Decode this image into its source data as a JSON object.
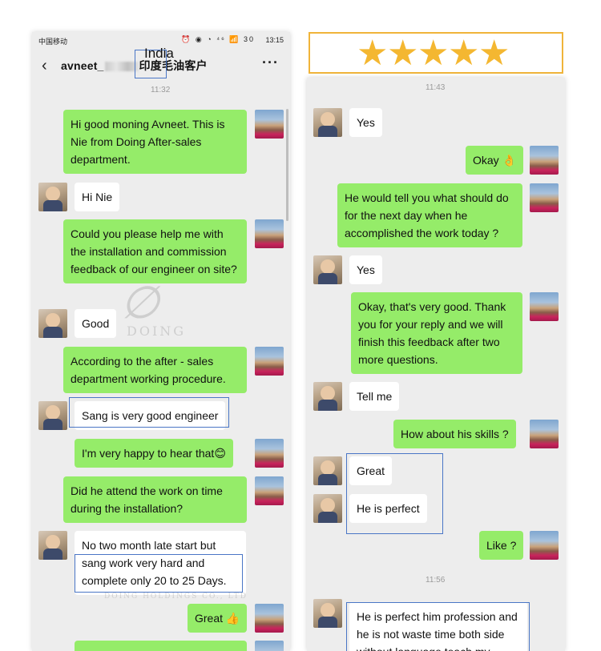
{
  "left": {
    "statusbar": {
      "carrier": "中国移动",
      "icons": "⏰ ◉ ◔ ⁴⁶ 📶 30",
      "time": "13:15"
    },
    "title": {
      "back": "‹",
      "name": "avneet_",
      "name_suffix": "印度毛油客户",
      "more": "···"
    },
    "annotation": "India",
    "timestamp": "11:32",
    "messages": [
      {
        "from": "me",
        "text": "Hi good moning Avneet. This is Nie from Doing After-sales department."
      },
      {
        "from": "them",
        "text": "Hi Nie"
      },
      {
        "from": "me",
        "text": "Could you please help me with the installation and commission feedback of our engineer on site?"
      },
      {
        "from": "them",
        "text": "Good"
      },
      {
        "from": "me",
        "text": "According to the after - sales department working procedure."
      },
      {
        "from": "them",
        "text": "Sang is very good engineer"
      },
      {
        "from": "me",
        "text": "I'm very happy to hear that😊"
      },
      {
        "from": "me",
        "text": "Did he attend the work on time during the installation?"
      },
      {
        "from": "them",
        "text": "No two month late start but sang work very hard and complete only 20 to 25 Days."
      },
      {
        "from": "me",
        "text": "Great 👍"
      }
    ],
    "watermark": {
      "logo": "DOING",
      "company": "DOING HOLDINGS CO., LTD"
    }
  },
  "right": {
    "rating": {
      "stars": 5,
      "symbol": "★"
    },
    "timestamp1": "11:43",
    "timestamp2": "11:56",
    "messages": [
      {
        "from": "them",
        "text": "Yes"
      },
      {
        "from": "me",
        "text": "Okay 👌"
      },
      {
        "from": "me",
        "text": "He would tell you what should do for the next day when he accomplished the work today ?"
      },
      {
        "from": "them",
        "text": "Yes"
      },
      {
        "from": "me",
        "text": "Okay, that's very good. Thank you for your reply and we will finish this feedback after two more questions."
      },
      {
        "from": "them",
        "text": "Tell me"
      },
      {
        "from": "me",
        "text": "How about his skills ?"
      },
      {
        "from": "them",
        "text": "Great"
      },
      {
        "from": "them",
        "text": "He is perfect"
      },
      {
        "from": "me",
        "text": "Like ?"
      },
      {
        "from": "them",
        "text": "He is perfect him profession and he is not waste time both side without language teach my"
      }
    ]
  },
  "colors": {
    "my_bubble": "#95ec69",
    "their_bubble": "#ffffff",
    "chat_bg": "#ededed",
    "annotation": "#4a76c6",
    "star": "#f4b731",
    "star_border": "#f0b43a"
  }
}
